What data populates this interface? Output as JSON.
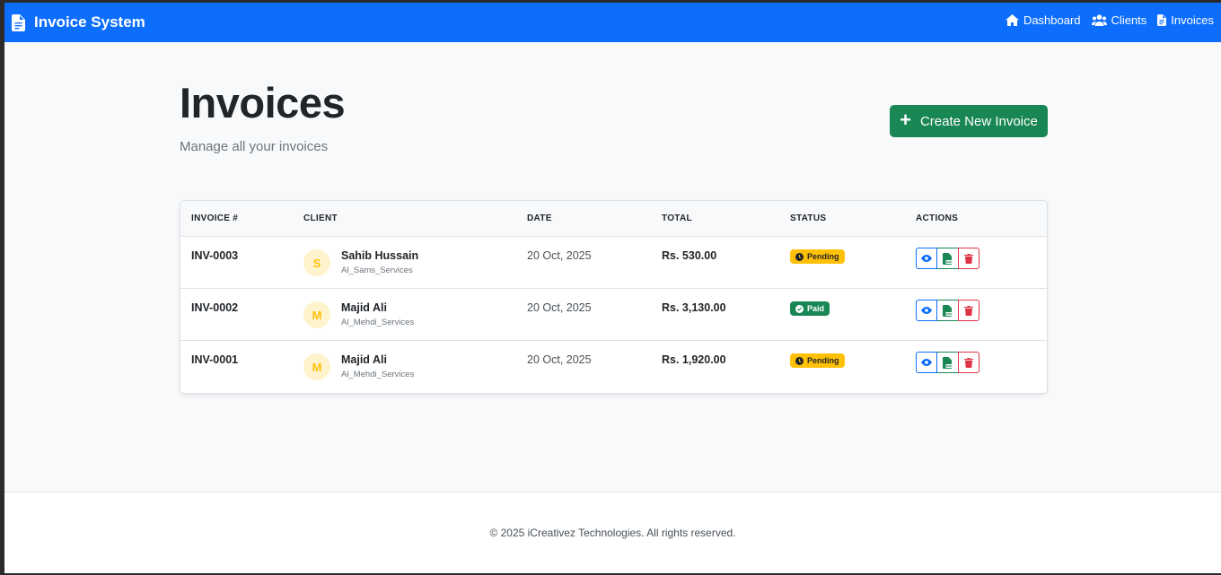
{
  "navbar": {
    "brand": "Invoice System",
    "links": [
      {
        "label": "Dashboard",
        "icon": "home-icon"
      },
      {
        "label": "Clients",
        "icon": "users-icon"
      },
      {
        "label": "Invoices",
        "icon": "invoice-file-icon"
      }
    ]
  },
  "header": {
    "title": "Invoices",
    "subtitle": "Manage all your invoices",
    "create_button": "Create New Invoice"
  },
  "table": {
    "columns": [
      "INVOICE #",
      "CLIENT",
      "DATE",
      "TOTAL",
      "STATUS",
      "ACTIONS"
    ],
    "rows": [
      {
        "invoice": "INV-0003",
        "initial": "S",
        "client": "Sahib Hussain",
        "company": "Al_Sams_Services",
        "date": "20 Oct, 2025",
        "total": "Rs. 530.00",
        "status": "Pending"
      },
      {
        "invoice": "INV-0002",
        "initial": "M",
        "client": "Majid Ali",
        "company": "Al_Mehdi_Services",
        "date": "20 Oct, 2025",
        "total": "Rs. 3,130.00",
        "status": "Paid"
      },
      {
        "invoice": "INV-0001",
        "initial": "M",
        "client": "Majid Ali",
        "company": "Al_Mehdi_Services",
        "date": "20 Oct, 2025",
        "total": "Rs. 1,920.00",
        "status": "Pending"
      }
    ]
  },
  "footer": {
    "text": "© 2025 iCreativez Technologies. All rights reserved."
  },
  "colors": {
    "primary": "#0d6efd",
    "success": "#198754",
    "warning": "#ffc107",
    "danger": "#dc3545"
  }
}
